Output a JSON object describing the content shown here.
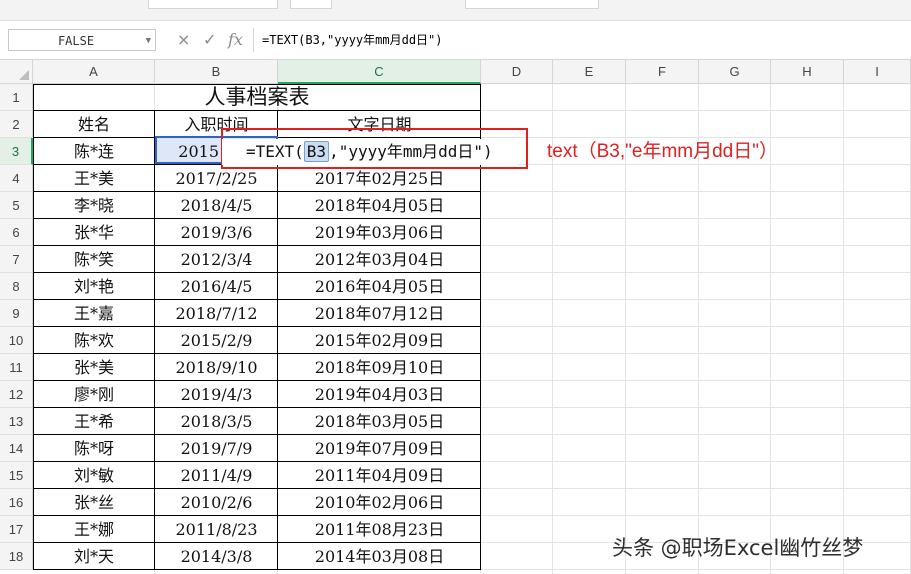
{
  "formula_bar": {
    "name_box": "FALSE",
    "cancel_icon": "×",
    "confirm_icon": "✓",
    "fx_label": "fx",
    "formula": "=TEXT(B3,\"yyyy年mm月dd日\")"
  },
  "columns": [
    "A",
    "B",
    "C",
    "D",
    "E",
    "F",
    "G",
    "H",
    "I"
  ],
  "rows": [
    "1",
    "2",
    "3",
    "4",
    "5",
    "6",
    "7",
    "8",
    "9",
    "10",
    "11",
    "12",
    "13",
    "14",
    "15",
    "16",
    "17",
    "18"
  ],
  "sheet": {
    "title": "人事档案表",
    "headers": {
      "name": "姓名",
      "hire_date": "入职时间",
      "text_date": "文字日期"
    },
    "row3": {
      "name": "陈*连",
      "hire_date": "2015"
    },
    "records": [
      {
        "name": "王*美",
        "hire_date": "2017/2/25",
        "text_date": "2017年02月25日"
      },
      {
        "name": "李*晓",
        "hire_date": "2018/4/5",
        "text_date": "2018年04月05日"
      },
      {
        "name": "张*华",
        "hire_date": "2019/3/6",
        "text_date": "2019年03月06日"
      },
      {
        "name": "陈*笑",
        "hire_date": "2012/3/4",
        "text_date": "2012年03月04日"
      },
      {
        "name": "刘*艳",
        "hire_date": "2016/4/5",
        "text_date": "2016年04月05日"
      },
      {
        "name": "王*嘉",
        "hire_date": "2018/7/12",
        "text_date": "2018年07月12日"
      },
      {
        "name": "陈*欢",
        "hire_date": "2015/2/9",
        "text_date": "2015年02月09日"
      },
      {
        "name": "张*美",
        "hire_date": "2018/9/10",
        "text_date": "2018年09月10日"
      },
      {
        "name": "廖*刚",
        "hire_date": "2019/4/3",
        "text_date": "2019年04月03日"
      },
      {
        "name": "王*希",
        "hire_date": "2018/3/5",
        "text_date": "2018年03月05日"
      },
      {
        "name": "陈*呀",
        "hire_date": "2019/7/9",
        "text_date": "2019年07月09日"
      },
      {
        "name": "刘*敏",
        "hire_date": "2011/4/9",
        "text_date": "2011年04月09日"
      },
      {
        "name": "张*丝",
        "hire_date": "2010/2/6",
        "text_date": "2010年02月06日"
      },
      {
        "name": "王*娜",
        "hire_date": "2011/8/23",
        "text_date": "2011年08月23日"
      },
      {
        "name": "刘*天",
        "hire_date": "2014/3/8",
        "text_date": "2014年03月08日"
      }
    ]
  },
  "in_cell_editor": {
    "prefix": "=TEXT(",
    "ref": "B3",
    "suffix": ",\"yyyy年mm月dd日\")"
  },
  "annotation": "text（B3,\"e年mm月dd日\"）",
  "watermark": "头条 @职场Excel幽竹丝梦",
  "colors": {
    "accent_green": "#21a366",
    "annotation_red": "#e02020",
    "selection_blue": "#2f63c7"
  }
}
